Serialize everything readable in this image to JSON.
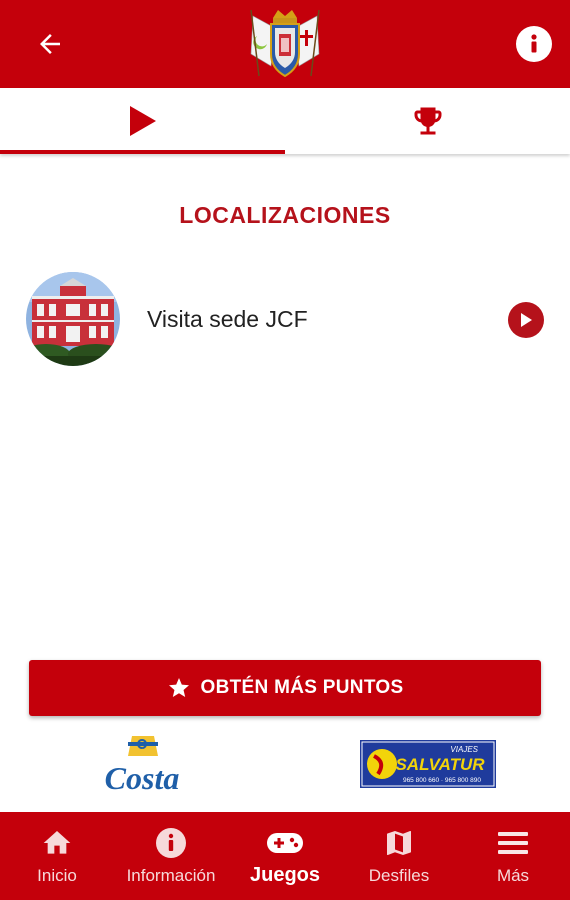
{
  "header": {
    "back_icon": "arrow-left-icon",
    "info_icon": "info-icon",
    "logo": "coat-of-arms-logo",
    "colors": {
      "bar": "#c4000b"
    }
  },
  "tabs": [
    {
      "icon": "play-icon",
      "selected": true
    },
    {
      "icon": "trophy-icon",
      "selected": false
    }
  ],
  "section": {
    "title": "LOCALIZACIONES"
  },
  "locations": [
    {
      "label": "Visita sede JCF",
      "action_icon": "play-circle-icon"
    }
  ],
  "cta": {
    "label": "OBTÉN MÁS PUNTOS",
    "icon": "star-icon"
  },
  "sponsors": [
    {
      "name": "Costa"
    },
    {
      "name": "SALVATUR",
      "prefix": "VIAJES",
      "phones": "965 800 660 · 965 800 890"
    }
  ],
  "bottom_nav": [
    {
      "label": "Inicio",
      "icon": "home-icon"
    },
    {
      "label": "Información",
      "icon": "info-icon"
    },
    {
      "label": "Juegos",
      "icon": "gamepad-icon",
      "active": true
    },
    {
      "label": "Desfiles",
      "icon": "map-icon"
    },
    {
      "label": "Más",
      "icon": "menu-icon"
    }
  ]
}
